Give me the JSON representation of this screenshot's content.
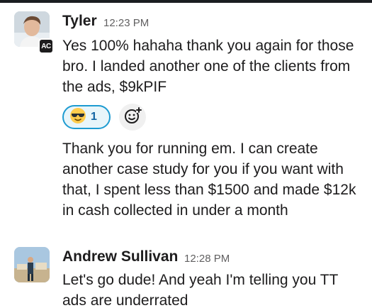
{
  "messages": [
    {
      "author": "Tyler",
      "time": "12:23 PM",
      "app_badge": "AC",
      "text": "Yes 100% hahaha thank you again for those bro. I landed another one of the clients from the ads, $9kPIF",
      "reactions": [
        {
          "emoji": "sunglasses-emoji",
          "count": "1"
        }
      ],
      "followup_text": "Thank you for running em. I can create another case study for you if you want with that, I spent less than $1500 and made $12k in cash collected in under a month"
    },
    {
      "author": "Andrew Sullivan",
      "time": "12:28 PM",
      "text": "Let's go dude! And yeah I'm telling you TT ads are underrated"
    }
  ],
  "icons": {
    "add_reaction": "add-reaction-icon",
    "reaction_emoji": "sunglasses-emoji"
  },
  "colors": {
    "reaction_border": "#1d9bd1",
    "reaction_bg": "#e8f5fa",
    "reaction_count": "#1264a3"
  }
}
